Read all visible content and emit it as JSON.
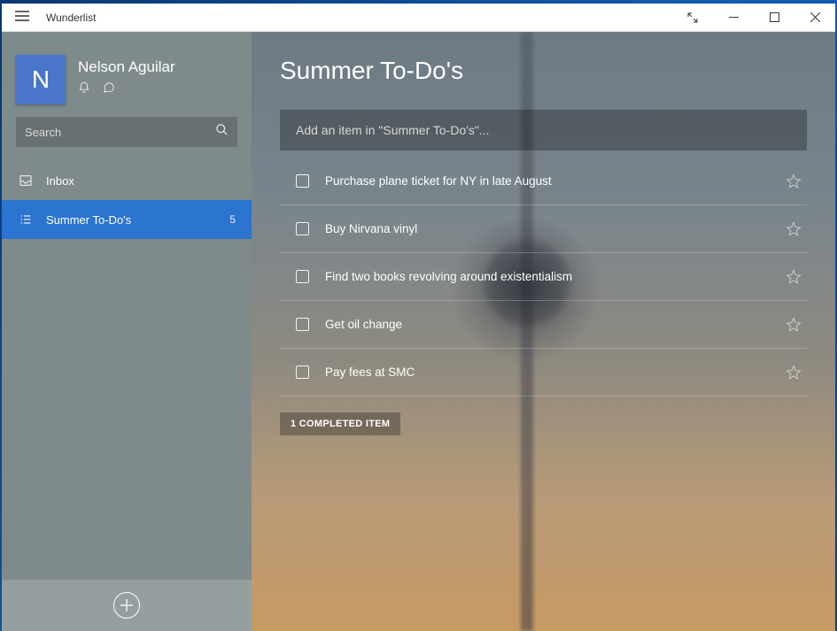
{
  "app": {
    "title": "Wunderlist"
  },
  "profile": {
    "initial": "N",
    "name": "Nelson Aguilar"
  },
  "search": {
    "placeholder": "Search"
  },
  "sidebar": {
    "items": [
      {
        "label": "Inbox",
        "count": ""
      },
      {
        "label": "Summer To-Do's",
        "count": "5"
      }
    ]
  },
  "main": {
    "title": "Summer To-Do's",
    "add_placeholder": "Add an item in \"Summer To-Do's\"...",
    "tasks": [
      {
        "title": "Purchase plane ticket for NY in late August"
      },
      {
        "title": "Buy Nirvana vinyl"
      },
      {
        "title": "Find two books revolving around existentialism"
      },
      {
        "title": "Get oil change"
      },
      {
        "title": "Pay fees at SMC"
      }
    ],
    "completed_label": "1 COMPLETED ITEM"
  }
}
